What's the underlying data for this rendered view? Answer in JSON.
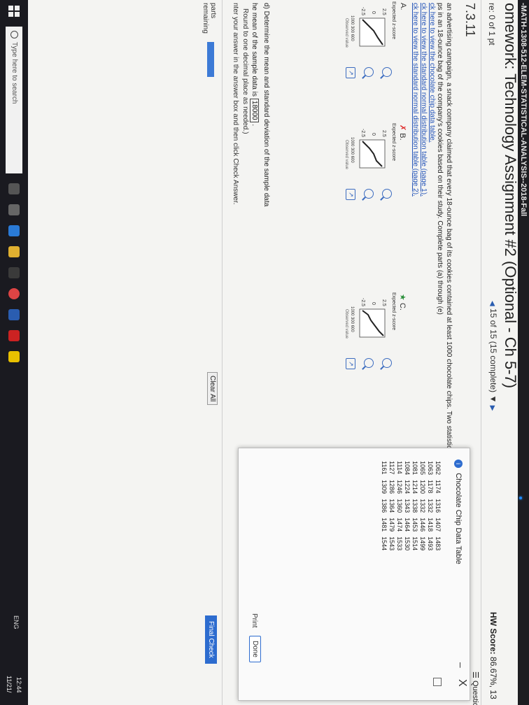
{
  "course_bar": "-MATH-1308-512-ELEM-STATISTICAL-ANALYSIS--2018-Fall",
  "hw_title": "omework: Technology Assignment #2 (Optional - Ch 5-7)",
  "score_line": "re: 0 of 1 pt",
  "nav_text": "15 of 15 (15 complete)",
  "hw_score_label": "HW Score:",
  "hw_score_value": "86.67%, 13",
  "question_menu": "Question H",
  "question_id": "7.3.11",
  "prompt_line1": "an advertising campaign, a snack company claimed that every 18-ounce bag of its cookies contained at least 1000 chocolate chips. Two statistic",
  "prompt_line2": "ps in an 18-ounce bag of the company's cookies based on their study. Complete parts (a) through (e)",
  "links": [
    "ck here to view the chocolate chip data table.",
    "ck here to view the standard normal distribution table (page 1).",
    "ck here to view the standard normal distribution table (page 2)."
  ],
  "options": {
    "a_label": "A.",
    "b_label": "B.",
    "c_label": "C."
  },
  "plot_labels": {
    "title": "Expected z-score",
    "tick_top": "2.5",
    "tick_mid": "0",
    "tick_bot": "-2.5",
    "xticks": "1000 300 600",
    "xlabel": "Observed value"
  },
  "part_d": "d) Determine the mean and standard deviation of the sample data",
  "mean_prefix": "he mean of the sample data is",
  "mean_value": "18000",
  "mean_suffix": ".",
  "round_note": "Round to one decimal place as needed.)",
  "enter_note": "nter your answer in the answer box and then click Check Answer.",
  "parts_label_1": "parts",
  "parts_label_2": "remaining",
  "clear_all": "Clear All",
  "final_check": "Final Check",
  "dialog": {
    "title": "Chocolate Chip Data Table",
    "minimize": "–",
    "close": "X",
    "rows": [
      [
        "1062",
        "1174",
        "1316",
        "1407",
        "1483"
      ],
      [
        "1063",
        "1178",
        "1332",
        "1418",
        "1493"
      ],
      [
        "1065",
        "1200",
        "1332",
        "1446",
        "1499"
      ],
      [
        "1081",
        "1214",
        "1338",
        "1453",
        "1514"
      ],
      [
        "1084",
        "1224",
        "1343",
        "1464",
        "1530"
      ],
      [
        "1114",
        "1246",
        "1360",
        "1474",
        "1533"
      ],
      [
        "1127",
        "1286",
        "1364",
        "1479",
        "1543"
      ],
      [
        "1161",
        "1309",
        "1386",
        "1481",
        "1544"
      ]
    ],
    "print": "Print",
    "done": "Done"
  },
  "taskbar": {
    "search_placeholder": "Type here to search",
    "tray": "ENG",
    "time": "12:44",
    "date": "11/21/"
  },
  "colors": {
    "accent": "#2d6ccf",
    "link": "#2454b8",
    "course_bar": "#1d1d21"
  }
}
